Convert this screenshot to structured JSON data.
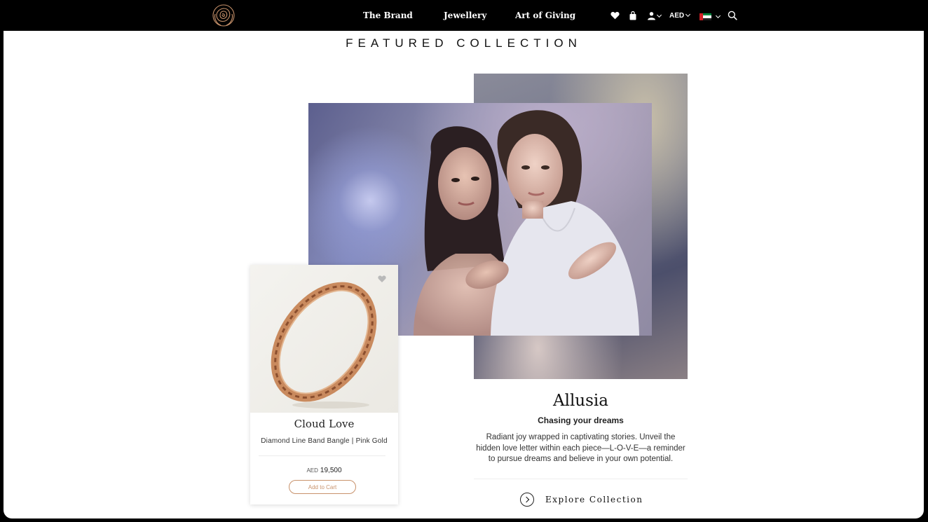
{
  "nav": {
    "links": [
      "The Brand",
      "Jewellery",
      "Art of Giving"
    ],
    "currency": "AED",
    "icons": [
      "rose-logo",
      "heart-icon",
      "shopping-bag-icon",
      "user-icon",
      "uae-flag-icon",
      "search-icon"
    ]
  },
  "section": {
    "title": "FEATURED COLLECTION"
  },
  "product": {
    "name": "Cloud Love",
    "description": "Diamond Line Band Bangle | Pink Gold",
    "currency": "AED",
    "price": "19,500",
    "cta": "Add to Cart"
  },
  "collection": {
    "title": "Allusia",
    "subtitle": "Chasing your dreams",
    "description": "Radiant joy wrapped in captivating stories. Unveil the hidden love letter within each piece—L-O-V-E—a reminder to pursue dreams and believe in your own potential.",
    "cta": "Explore Collection"
  },
  "colors": {
    "accent": "#c8926b",
    "nav_bg": "#000000"
  }
}
